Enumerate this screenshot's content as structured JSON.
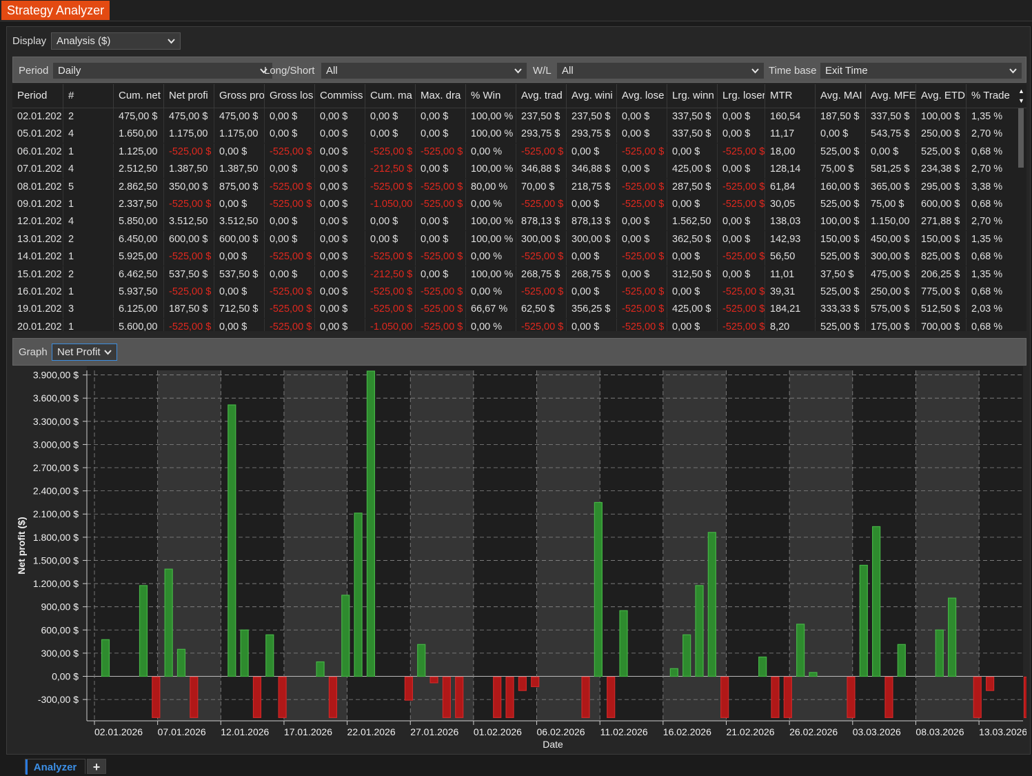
{
  "app": {
    "title": "Strategy Analyzer"
  },
  "display": {
    "label": "Display",
    "value": "Analysis ($)"
  },
  "filters": {
    "period_label": "Period",
    "period_value": "Daily",
    "longshort_label": "Long/Short",
    "longshort_value": "All",
    "wl_label": "W/L",
    "wl_value": "All",
    "timebase_label": "Time base",
    "timebase_value": "Exit Time"
  },
  "table": {
    "columns": [
      "Period",
      "#",
      "Cum. net",
      "Net profi",
      "Gross pro",
      "Gross los",
      "Commiss",
      "Cum. ma",
      "Max. dra",
      "% Win",
      "Avg. trad",
      "Avg. wini",
      "Avg. lose",
      "Lrg. winn",
      "Lrg. loser",
      "MTR",
      "Avg. MAI",
      "Avg. MFE",
      "Avg. ETD",
      "% Trade"
    ],
    "rows": [
      [
        "02.01.202",
        "2",
        "475,00 $",
        "475,00 $",
        "475,00 $",
        "0,00 $",
        "0,00 $",
        "0,00 $",
        "0,00 $",
        "100,00 %",
        "237,50 $",
        "237,50 $",
        "0,00 $",
        "337,50 $",
        "0,00 $",
        "160,54",
        "187,50 $",
        "337,50 $",
        "100,00 $",
        "1,35 %"
      ],
      [
        "05.01.202",
        "4",
        "1.650,00",
        "1.175,00",
        "1.175,00",
        "0,00 $",
        "0,00 $",
        "0,00 $",
        "0,00 $",
        "100,00 %",
        "293,75 $",
        "293,75 $",
        "0,00 $",
        "337,50 $",
        "0,00 $",
        "11,17",
        "0,00 $",
        "543,75 $",
        "250,00 $",
        "2,70 %"
      ],
      [
        "06.01.202",
        "1",
        "1.125,00",
        "-525,00 $",
        "0,00 $",
        "-525,00 $",
        "0,00 $",
        "-525,00 $",
        "-525,00 $",
        "0,00 %",
        "-525,00 $",
        "0,00 $",
        "-525,00 $",
        "0,00 $",
        "-525,00 $",
        "18,00",
        "525,00 $",
        "0,00 $",
        "525,00 $",
        "0,68 %"
      ],
      [
        "07.01.202",
        "4",
        "2.512,50",
        "1.387,50",
        "1.387,50",
        "0,00 $",
        "0,00 $",
        "-212,50 $",
        "0,00 $",
        "100,00 %",
        "346,88 $",
        "346,88 $",
        "0,00 $",
        "425,00 $",
        "0,00 $",
        "128,14",
        "75,00 $",
        "581,25 $",
        "234,38 $",
        "2,70 %"
      ],
      [
        "08.01.202",
        "5",
        "2.862,50",
        "350,00 $",
        "875,00 $",
        "-525,00 $",
        "0,00 $",
        "-525,00 $",
        "-525,00 $",
        "80,00 %",
        "70,00 $",
        "218,75 $",
        "-525,00 $",
        "287,50 $",
        "-525,00 $",
        "61,84",
        "160,00 $",
        "365,00 $",
        "295,00 $",
        "3,38 %"
      ],
      [
        "09.01.202",
        "1",
        "2.337,50",
        "-525,00 $",
        "0,00 $",
        "-525,00 $",
        "0,00 $",
        "-1.050,00",
        "-525,00 $",
        "0,00 %",
        "-525,00 $",
        "0,00 $",
        "-525,00 $",
        "0,00 $",
        "-525,00 $",
        "30,05",
        "525,00 $",
        "75,00 $",
        "600,00 $",
        "0,68 %"
      ],
      [
        "12.01.202",
        "4",
        "5.850,00",
        "3.512,50",
        "3.512,50",
        "0,00 $",
        "0,00 $",
        "0,00 $",
        "0,00 $",
        "100,00 %",
        "878,13 $",
        "878,13 $",
        "0,00 $",
        "1.562,50",
        "0,00 $",
        "138,03",
        "100,00 $",
        "1.150,00",
        "271,88 $",
        "2,70 %"
      ],
      [
        "13.01.202",
        "2",
        "6.450,00",
        "600,00 $",
        "600,00 $",
        "0,00 $",
        "0,00 $",
        "0,00 $",
        "0,00 $",
        "100,00 %",
        "300,00 $",
        "300,00 $",
        "0,00 $",
        "362,50 $",
        "0,00 $",
        "142,93",
        "150,00 $",
        "450,00 $",
        "150,00 $",
        "1,35 %"
      ],
      [
        "14.01.202",
        "1",
        "5.925,00",
        "-525,00 $",
        "0,00 $",
        "-525,00 $",
        "0,00 $",
        "-525,00 $",
        "-525,00 $",
        "0,00 %",
        "-525,00 $",
        "0,00 $",
        "-525,00 $",
        "0,00 $",
        "-525,00 $",
        "56,50",
        "525,00 $",
        "300,00 $",
        "825,00 $",
        "0,68 %"
      ],
      [
        "15.01.202",
        "2",
        "6.462,50",
        "537,50 $",
        "537,50 $",
        "0,00 $",
        "0,00 $",
        "-212,50 $",
        "0,00 $",
        "100,00 %",
        "268,75 $",
        "268,75 $",
        "0,00 $",
        "312,50 $",
        "0,00 $",
        "11,01",
        "37,50 $",
        "475,00 $",
        "206,25 $",
        "1,35 %"
      ],
      [
        "16.01.202",
        "1",
        "5.937,50",
        "-525,00 $",
        "0,00 $",
        "-525,00 $",
        "0,00 $",
        "-525,00 $",
        "-525,00 $",
        "0,00 %",
        "-525,00 $",
        "0,00 $",
        "-525,00 $",
        "0,00 $",
        "-525,00 $",
        "39,31",
        "525,00 $",
        "250,00 $",
        "775,00 $",
        "0,68 %"
      ],
      [
        "19.01.202",
        "3",
        "6.125,00",
        "187,50 $",
        "712,50 $",
        "-525,00 $",
        "0,00 $",
        "-525,00 $",
        "-525,00 $",
        "66,67 %",
        "62,50 $",
        "356,25 $",
        "-525,00 $",
        "425,00 $",
        "-525,00 $",
        "184,21",
        "333,33 $",
        "575,00 $",
        "512,50 $",
        "2,03 %"
      ],
      [
        "20.01.202",
        "1",
        "5.600,00",
        "-525,00 $",
        "0,00 $",
        "-525,00 $",
        "0,00 $",
        "-1.050,00",
        "-525,00 $",
        "0,00 %",
        "-525,00 $",
        "0,00 $",
        "-525,00 $",
        "0,00 $",
        "-525,00 $",
        "8,20",
        "525,00 $",
        "175,00 $",
        "700,00 $",
        "0,68 %"
      ]
    ]
  },
  "graph": {
    "label": "Graph",
    "value": "Net Profit"
  },
  "chart_data": {
    "type": "bar",
    "xlabel": "Date",
    "ylabel": "Net profit ($)",
    "ylim": [
      -525,
      3900
    ],
    "yticks": [
      "3.900,00 $",
      "3.600,00 $",
      "3.300,00 $",
      "3.000,00 $",
      "2.700,00 $",
      "2.400,00 $",
      "2.100,00 $",
      "1.800,00 $",
      "1.500,00 $",
      "1.200,00 $",
      "900,00 $",
      "600,00 $",
      "300,00 $",
      "0,00 $",
      "-300,00 $"
    ],
    "ytick_values": [
      3900,
      3600,
      3300,
      3000,
      2700,
      2400,
      2100,
      1800,
      1500,
      1200,
      900,
      600,
      300,
      0,
      -300
    ],
    "xticks": [
      "02.01.2026",
      "07.01.2026",
      "12.01.2026",
      "17.01.2026",
      "22.01.2026",
      "27.01.2026",
      "01.02.2026",
      "06.02.2026",
      "11.02.2026",
      "16.02.2026",
      "21.02.2026",
      "26.02.2026",
      "03.03.2026",
      "08.03.2026",
      "13.03.2026"
    ],
    "grid": true,
    "positive_color": "#2e8b2e",
    "negative_color": "#b01818",
    "bars": [
      {
        "date": "02.01.2026",
        "value": 475
      },
      {
        "date": "05.01.2026",
        "value": 1175
      },
      {
        "date": "06.01.2026",
        "value": -525
      },
      {
        "date": "07.01.2026",
        "value": 1387.5
      },
      {
        "date": "08.01.2026",
        "value": 350
      },
      {
        "date": "09.01.2026",
        "value": -525
      },
      {
        "date": "12.01.2026",
        "value": 3512.5
      },
      {
        "date": "13.01.2026",
        "value": 600
      },
      {
        "date": "14.01.2026",
        "value": -525
      },
      {
        "date": "15.01.2026",
        "value": 537.5
      },
      {
        "date": "16.01.2026",
        "value": -525
      },
      {
        "date": "19.01.2026",
        "value": 187.5
      },
      {
        "date": "20.01.2026",
        "value": -525
      },
      {
        "date": "21.01.2026",
        "value": 1050
      },
      {
        "date": "22.01.2026",
        "value": 2112.5
      },
      {
        "date": "23.01.2026",
        "value": 3950
      },
      {
        "date": "26.01.2026",
        "value": -300
      },
      {
        "date": "27.01.2026",
        "value": 412.5
      },
      {
        "date": "28.01.2026",
        "value": -75
      },
      {
        "date": "29.01.2026",
        "value": -525
      },
      {
        "date": "30.01.2026",
        "value": -525
      },
      {
        "date": "02.02.2026",
        "value": -525
      },
      {
        "date": "03.02.2026",
        "value": -525
      },
      {
        "date": "04.02.2026",
        "value": -175
      },
      {
        "date": "05.02.2026",
        "value": -125
      },
      {
        "date": "09.02.2026",
        "value": -525
      },
      {
        "date": "10.02.2026",
        "value": 2250
      },
      {
        "date": "11.02.2026",
        "value": -525
      },
      {
        "date": "12.02.2026",
        "value": 850
      },
      {
        "date": "16.02.2026",
        "value": 100
      },
      {
        "date": "17.02.2026",
        "value": 537.5
      },
      {
        "date": "18.02.2026",
        "value": 1175
      },
      {
        "date": "19.02.2026",
        "value": 1862.5
      },
      {
        "date": "20.02.2026",
        "value": -525
      },
      {
        "date": "23.02.2026",
        "value": 250
      },
      {
        "date": "24.02.2026",
        "value": -525
      },
      {
        "date": "25.02.2026",
        "value": -525
      },
      {
        "date": "26.02.2026",
        "value": 675
      },
      {
        "date": "27.02.2026",
        "value": 50
      },
      {
        "date": "02.03.2026",
        "value": -525
      },
      {
        "date": "03.03.2026",
        "value": 1437.5
      },
      {
        "date": "04.03.2026",
        "value": 1937.5
      },
      {
        "date": "05.03.2026",
        "value": -525
      },
      {
        "date": "06.03.2026",
        "value": 412.5
      },
      {
        "date": "09.03.2026",
        "value": 600
      },
      {
        "date": "10.03.2026",
        "value": 1012.5
      },
      {
        "date": "12.03.2026",
        "value": -525
      },
      {
        "date": "13.03.2026",
        "value": -175
      },
      {
        "date": "16.03.2026",
        "value": -525
      }
    ]
  },
  "tabs": {
    "active": "Analyzer",
    "add": "+"
  }
}
